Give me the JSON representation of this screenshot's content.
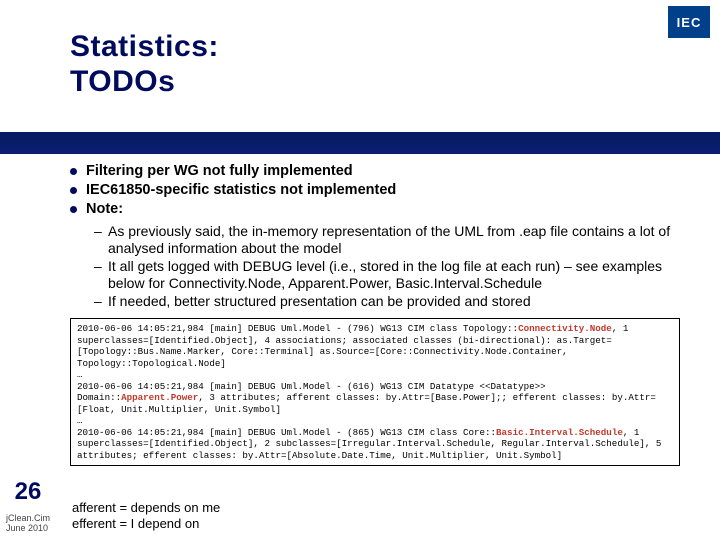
{
  "logo": "IEC",
  "title_line1": "Statistics:",
  "title_line2": "TODOs",
  "bullets": [
    "Filtering per WG not fully implemented",
    "IEC61850-specific statistics not implemented",
    "Note:"
  ],
  "subbullets": [
    "As previously said, the in-memory representation of the UML from .eap file contains a lot of analysed information about the model",
    "It all gets logged with DEBUG level (i.e., stored in the log file at each run) – see examples below for Connectivity.Node, Apparent.Power, Basic.Interval.Schedule",
    "If needed, better structured presentation can be provided and stored"
  ],
  "code": {
    "l1a": "2010-06-06 14:05:21,984 [main] DEBUG Uml.Model - (796) WG13 CIM class Topology::",
    "l1hl": "Connectivity.Node",
    "l1b": ", 1 superclasses=[Identified.Object], 4 associations; associated classes (bi-directional): as.Target=[Topology::Bus.Name.Marker, Core::Terminal] as.Source=[Core::Connectivity.Node.Container, Topology::Topological.Node]",
    "e1": "…",
    "l2a": "2010-06-06 14:05:21,984 [main] DEBUG Uml.Model - (616) WG13 CIM Datatype <<Datatype>> Domain::",
    "l2hl": "Apparent.Power",
    "l2b": ", 3 attributes; afferent classes: by.Attr=[Base.Power];; efferent classes: by.Attr=[Float, Unit.Multiplier, Unit.Symbol]",
    "e2": "…",
    "l3a": "2010-06-06 14:05:21,984 [main] DEBUG Uml.Model - (865) WG13 CIM class Core::",
    "l3hl": "Basic.Interval.Schedule",
    "l3b": ", 1 superclasses=[Identified.Object], 2 subclasses=[Irregular.Interval.Schedule, Regular.Interval.Schedule], 5 attributes; efferent classes: by.Attr=[Absolute.Date.Time, Unit.Multiplier, Unit.Symbol]"
  },
  "page": "26",
  "footer_line1": "jClean.Cim",
  "footer_line2": "June 2010",
  "legend_line1": "afferent = depends on me",
  "legend_line2": "efferent = I depend on"
}
